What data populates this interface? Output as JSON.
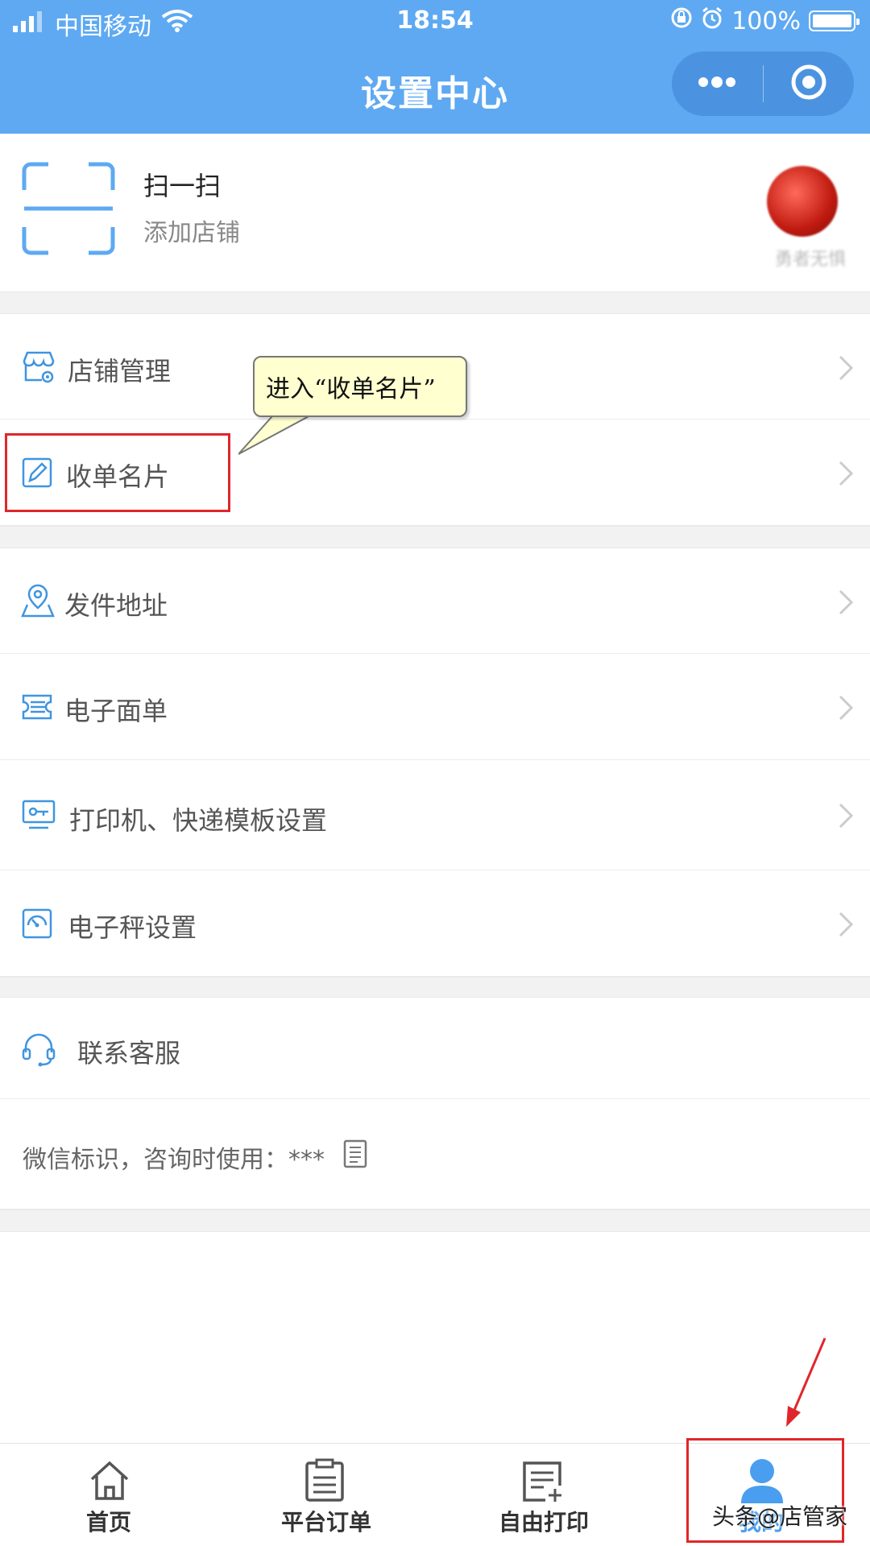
{
  "status_bar": {
    "carrier": "中国移动",
    "time": "18:54",
    "battery": "100%"
  },
  "nav": {
    "title": "设置中心"
  },
  "scan": {
    "title": "扫一扫",
    "subtitle": "添加店铺",
    "avatar_label": "勇者无惧"
  },
  "menu_group1": [
    {
      "label": "店铺管理",
      "icon": "store-gear-icon"
    },
    {
      "label": "收单名片",
      "icon": "card-edit-icon"
    }
  ],
  "menu_group2": [
    {
      "label": "发件地址",
      "icon": "location-pin-icon"
    },
    {
      "label": "电子面单",
      "icon": "ticket-icon"
    },
    {
      "label": "打印机、快递模板设置",
      "icon": "printer-monitor-icon"
    },
    {
      "label": "电子秤设置",
      "icon": "scale-gauge-icon"
    }
  ],
  "service": {
    "label": "联系客服",
    "icon": "headset-icon",
    "wechat_id_text": "微信标识，咨询时使用：***"
  },
  "tabbar": [
    {
      "label": "首页",
      "icon": "home-icon"
    },
    {
      "label": "平台订单",
      "icon": "clipboard-icon"
    },
    {
      "label": "自由打印",
      "icon": "note-plus-icon"
    },
    {
      "label": "我的",
      "icon": "user-icon"
    }
  ],
  "annotation": {
    "callout_text": "进入“收单名片”",
    "watermark": "头条@店管家",
    "highlight_color": "#e0262b"
  },
  "colors": {
    "brand_blue": "#5ea9f2",
    "icon_blue": "#3f95e0"
  }
}
